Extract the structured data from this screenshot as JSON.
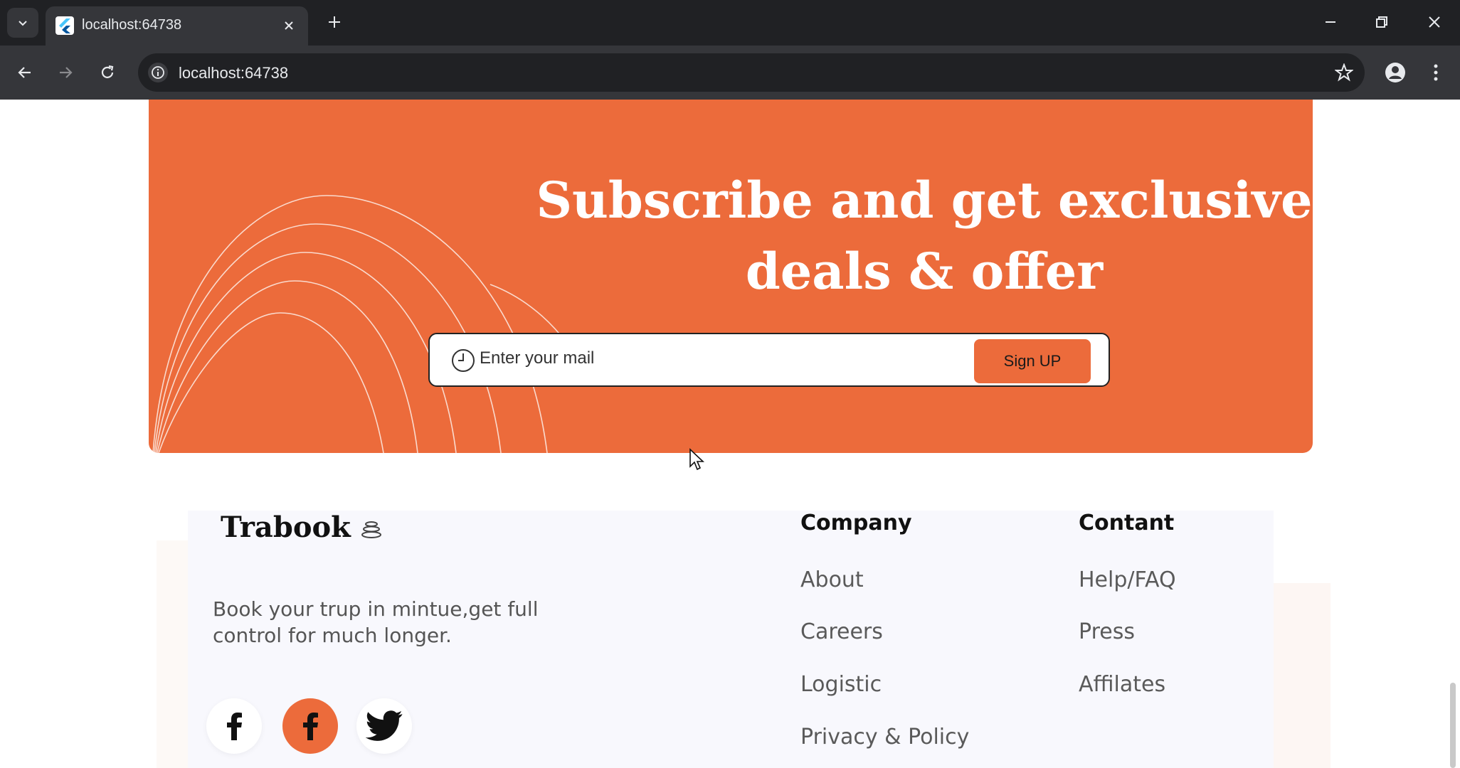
{
  "browser": {
    "tab_title": "localhost:64738",
    "url": "localhost:64738",
    "icons": {
      "tab_search": "chevron-down-icon",
      "favicon": "flutter-logo-icon",
      "close_tab": "close-icon",
      "new_tab": "plus-icon",
      "back": "arrow-left-icon",
      "forward": "arrow-right-icon",
      "reload": "reload-icon",
      "site_info": "info-icon",
      "bookmark": "star-icon",
      "profile": "person-icon",
      "menu": "kebab-menu-icon",
      "minimize": "minimize-icon",
      "restore": "restore-icon",
      "close_window": "close-icon"
    }
  },
  "subscribe": {
    "headline_line1": "Subscribe and get exclusive",
    "headline_line2": "deals & offer",
    "input_placeholder": "Enter your mail",
    "signup_label": "Sign UP",
    "colors": {
      "banner": "#ec6b3b",
      "text": "#ffffff"
    }
  },
  "footer": {
    "brand": "Trabook",
    "tagline": "Book your trup in mintue,get full control for much longer.",
    "social": [
      {
        "name": "facebook",
        "icon": "facebook-icon",
        "style": "white"
      },
      {
        "name": "facebook",
        "icon": "facebook-icon",
        "style": "orange"
      },
      {
        "name": "twitter",
        "icon": "twitter-icon",
        "style": "white"
      }
    ],
    "columns": [
      {
        "title": "Company",
        "links": [
          "About",
          "Careers",
          "Logistic",
          "Privacy & Policy"
        ]
      },
      {
        "title": "Contant",
        "links": [
          "Help/FAQ",
          "Press",
          "Affilates"
        ]
      }
    ]
  }
}
